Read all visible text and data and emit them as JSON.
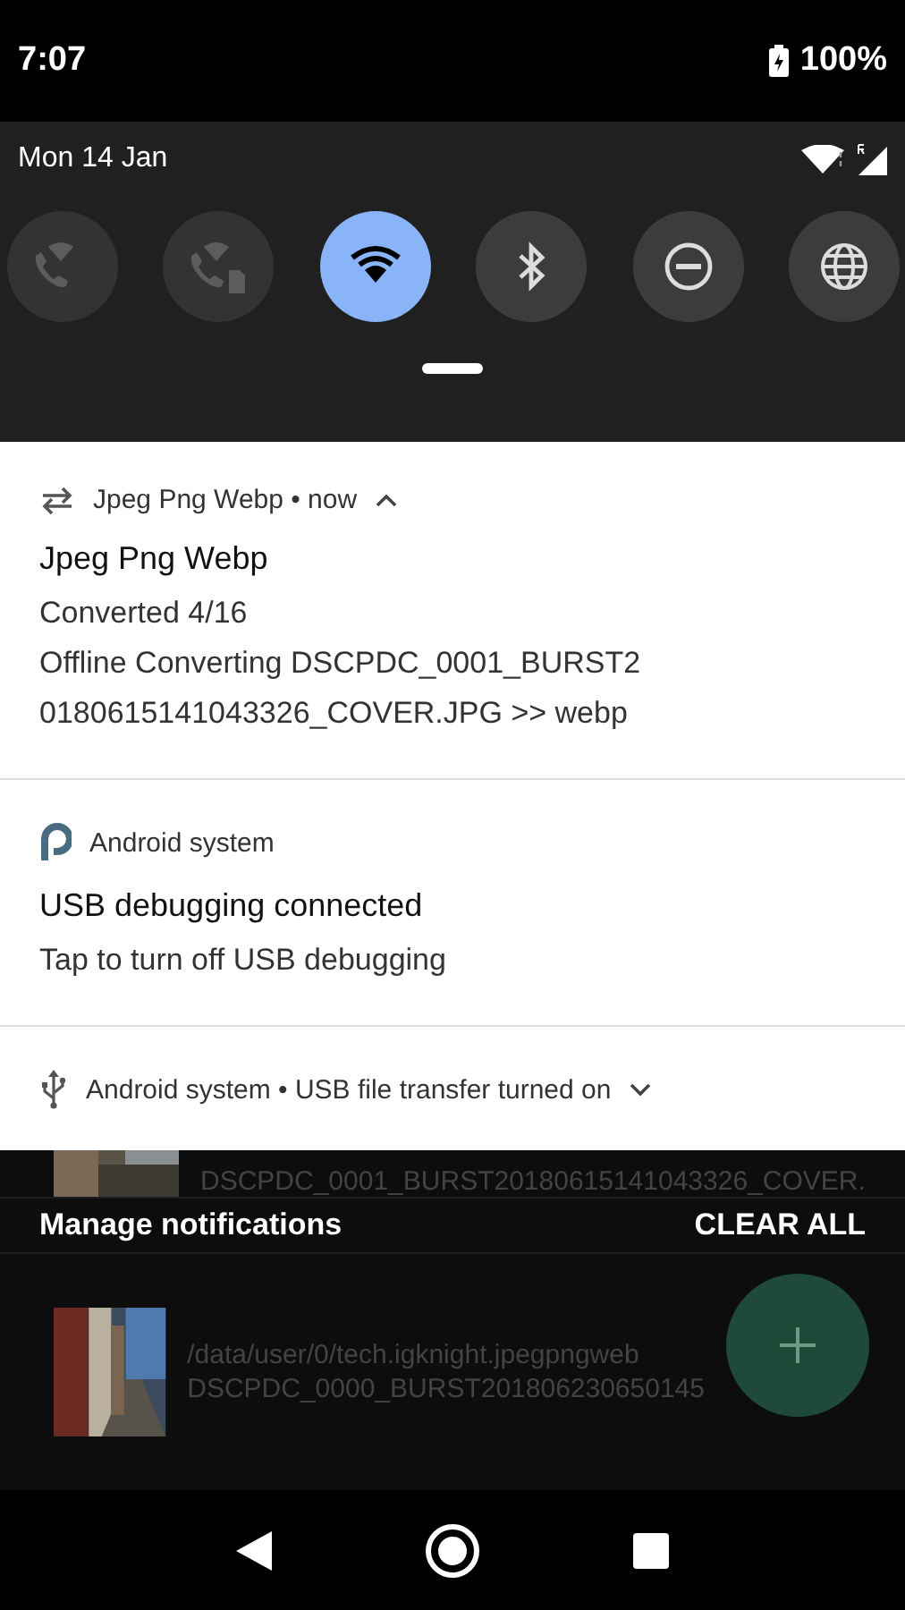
{
  "status_bar": {
    "time": "7:07",
    "battery": "100%"
  },
  "quick_settings": {
    "date": "Mon 14 Jan",
    "tiles": [
      {
        "kind": "wifi-calling",
        "on": false,
        "disabled": true
      },
      {
        "kind": "wifi-calling-sim2",
        "on": false,
        "disabled": true
      },
      {
        "kind": "wifi",
        "on": true,
        "disabled": false
      },
      {
        "kind": "bluetooth",
        "on": false,
        "disabled": false
      },
      {
        "kind": "do-not-disturb",
        "on": false,
        "disabled": false
      },
      {
        "kind": "globe",
        "on": false,
        "disabled": false
      }
    ]
  },
  "notifications": [
    {
      "kind": "convert",
      "header": "Jpeg Png Webp • now",
      "expanded": true,
      "title": "Jpeg Png Webp",
      "lines": [
        "Converted  4/16",
        "Offline Converting DSCPDC_0001_BURST20180615141043326_COVER.JPG >> webp"
      ]
    },
    {
      "kind": "system",
      "header": "Android system",
      "title": "USB debugging connected",
      "lines": [
        "Tap to turn off USB debugging"
      ]
    },
    {
      "kind": "usb",
      "header": "Android system • USB file transfer turned on",
      "expanded": false
    }
  ],
  "footer": {
    "manage": "Manage notifications",
    "clear": "CLEAR ALL"
  },
  "background_list": [
    {
      "line": "DSCPDC_0001_BURST20180615141043326_COVER."
    },
    {
      "path": "/data/user/0/tech.igknight.jpegpngweb",
      "line": "DSCPDC_0000_BURST201806230650145"
    }
  ]
}
